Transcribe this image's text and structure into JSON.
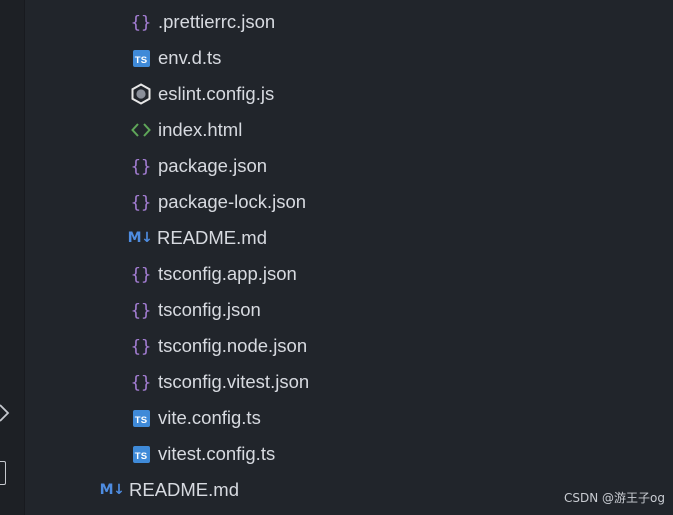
{
  "explorer": {
    "files": [
      {
        "name": ".prettierrc.json",
        "icon": "json-braces-icon"
      },
      {
        "name": "env.d.ts",
        "icon": "typescript-icon"
      },
      {
        "name": "eslint.config.js",
        "icon": "eslint-icon"
      },
      {
        "name": "index.html",
        "icon": "html-icon"
      },
      {
        "name": "package.json",
        "icon": "json-braces-icon"
      },
      {
        "name": "package-lock.json",
        "icon": "json-braces-icon"
      },
      {
        "name": "README.md",
        "icon": "markdown-icon"
      },
      {
        "name": "tsconfig.app.json",
        "icon": "json-braces-icon"
      },
      {
        "name": "tsconfig.json",
        "icon": "json-braces-icon"
      },
      {
        "name": "tsconfig.node.json",
        "icon": "json-braces-icon"
      },
      {
        "name": "tsconfig.vitest.json",
        "icon": "json-braces-icon"
      },
      {
        "name": "vite.config.ts",
        "icon": "typescript-icon"
      },
      {
        "name": "vitest.config.ts",
        "icon": "typescript-icon"
      }
    ],
    "parent_files": [
      {
        "name": "README.md",
        "icon": "markdown-icon"
      }
    ]
  },
  "badges": {
    "ts": "TS",
    "md": "M↓"
  },
  "watermark": "CSDN @游王子og",
  "colors": {
    "background": "#21252b",
    "json_icon": "#a67fd6",
    "ts_icon": "#3f8ad8",
    "md_icon": "#4e8ce0",
    "html_icon": "#5fa659",
    "text": "#d7dae0"
  }
}
